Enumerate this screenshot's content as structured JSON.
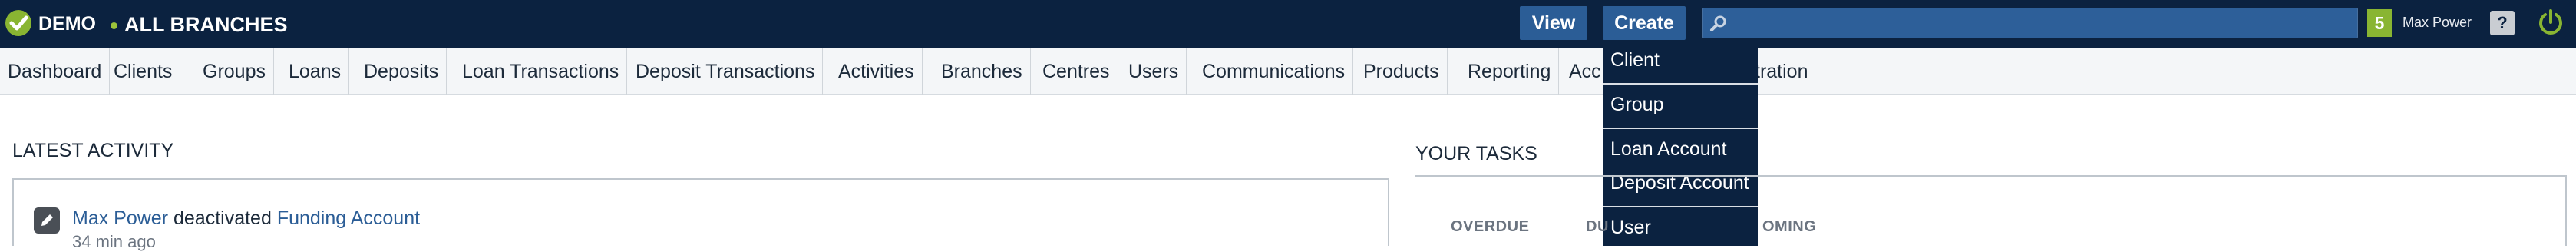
{
  "header": {
    "brand": "DEMO",
    "branch": "ALL BRANCHES",
    "view_label": "View",
    "create_label": "Create",
    "search_placeholder": "",
    "notifications_count": "5",
    "user_name": "Max Power",
    "help_label": "?"
  },
  "nav": {
    "items": [
      "Dashboard",
      "Clients",
      "Groups",
      "Loans",
      "Deposits",
      "Loan Transactions",
      "Deposit Transactions",
      "Activities",
      "Branches",
      "Centres",
      "Users",
      "Communications",
      "Products",
      "Reporting",
      "Acc",
      "tration"
    ]
  },
  "create_menu": {
    "items": [
      "Client",
      "Group",
      "Loan Account",
      "Deposit Account",
      "User"
    ]
  },
  "latest_activity": {
    "title": "LATEST ACTIVITY",
    "entries": [
      {
        "user": "Max Power",
        "action": " deactivated ",
        "target": "Funding Account",
        "time": "34 min ago"
      }
    ]
  },
  "tasks": {
    "title": "YOUR TASKS",
    "columns": [
      "OVERDUE",
      "DU",
      "OMING"
    ]
  },
  "colors": {
    "header_bg": "#0b2240",
    "button_bg": "#2b5d96",
    "accent_green": "#89b532",
    "link": "#2b5d96"
  },
  "icons": {
    "logo": "mambu-check-logo",
    "search": "search-icon",
    "power": "power-icon",
    "edit": "pencil-icon"
  }
}
